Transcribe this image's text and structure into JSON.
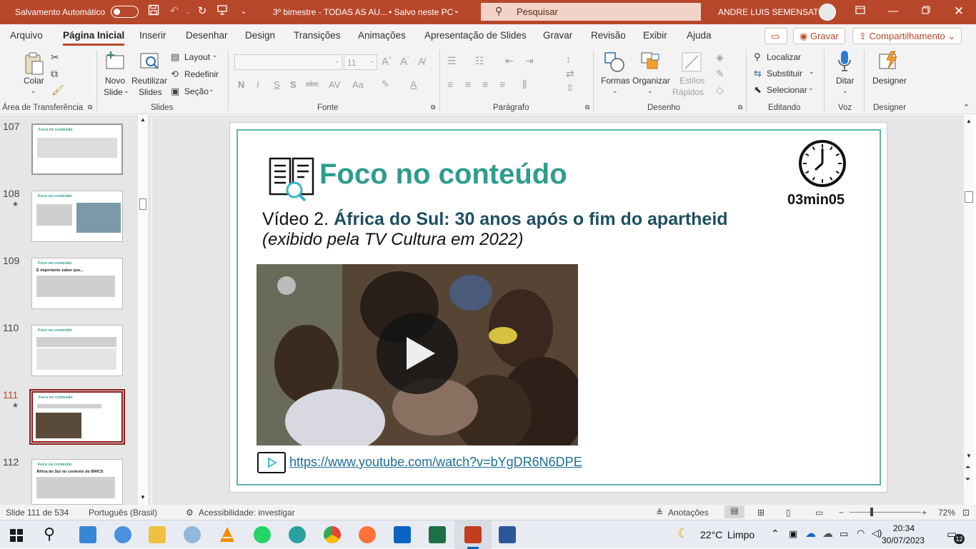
{
  "titlebar": {
    "autosave_label": "Salvamento Automático",
    "doc_title": "3º bimestre - TODAS AS AU...",
    "saved_status": "• Salvo neste PC",
    "search_placeholder": "Pesquisar",
    "user_name": "ANDRE LUIS SEMENSATO",
    "accent_color": "#b7472a"
  },
  "menu": {
    "tabs": [
      "Arquivo",
      "Página Inicial",
      "Inserir",
      "Desenhar",
      "Design",
      "Transições",
      "Animações",
      "Apresentação de Slides",
      "Gravar",
      "Revisão",
      "Exibir",
      "Ajuda"
    ],
    "active_tab": "Página Inicial",
    "record_button": "Gravar",
    "share_button": "Compartilhamento"
  },
  "ribbon": {
    "clipboard": {
      "paste": "Colar",
      "group": "Área de Transferência"
    },
    "slides": {
      "new_slide_1": "Novo",
      "new_slide_2": "Slide",
      "reuse_1": "Reutilizar",
      "reuse_2": "Slides",
      "layout": "Layout",
      "reset": "Redefinir",
      "section": "Seção",
      "group": "Slides"
    },
    "font": {
      "size": "11",
      "group": "Fonte",
      "bold": "N",
      "italic": "I",
      "underline": "S",
      "shadow": "S",
      "strike": "abc"
    },
    "paragraph": {
      "group": "Parágrafo"
    },
    "drawing": {
      "shapes": "Formas",
      "arrange": "Organizar",
      "styles_1": "Estilos",
      "styles_2": "Rápidos",
      "group": "Desenho"
    },
    "editing": {
      "find": "Localizar",
      "replace": "Substituir",
      "select": "Selecionar",
      "group": "Editando"
    },
    "voice": {
      "dictate": "Ditar",
      "group": "Voz"
    },
    "designer": {
      "label": "Designer",
      "group": "Designer"
    }
  },
  "slides_panel": {
    "items": [
      {
        "num": "107",
        "title": "Foco no conteúdo",
        "star": false,
        "selected": false
      },
      {
        "num": "108",
        "title": "Foco no conteúdo",
        "star": true,
        "selected": false
      },
      {
        "num": "109",
        "title": "Foco no conteúdo",
        "star": false,
        "selected": false,
        "subtitle": "É importante saber que..."
      },
      {
        "num": "110",
        "title": "Foco no conteúdo",
        "star": false,
        "selected": false
      },
      {
        "num": "111",
        "title": "Foco no conteúdo",
        "star": true,
        "selected": true
      },
      {
        "num": "112",
        "title": "Foco no conteúdo",
        "star": false,
        "selected": false,
        "subtitle": "África do Sul no contexto do BRICS"
      }
    ]
  },
  "slide": {
    "heading": "Foco no conteúdo",
    "timer": "03min05",
    "video_prefix": "Vídeo 2. ",
    "video_title": "África do Sul: 30 anos após o fim do apartheid",
    "video_note": "(exibido pela TV Cultura em 2022)",
    "link": "https://www.youtube.com/watch?v=bYgDR6N6DPE",
    "heading_color": "#2e9c8f",
    "title_color": "#1e5060"
  },
  "statusbar": {
    "slide_info": "Slide 111 de 534",
    "language": "Português (Brasil)",
    "accessibility": "Acessibilidade: investigar",
    "notes": "Anotações",
    "zoom": "72%"
  },
  "taskbar": {
    "weather_temp": "22°C",
    "weather_text": "Limpo",
    "time": "20:34",
    "date": "30/07/2023",
    "notif_count": "12"
  }
}
